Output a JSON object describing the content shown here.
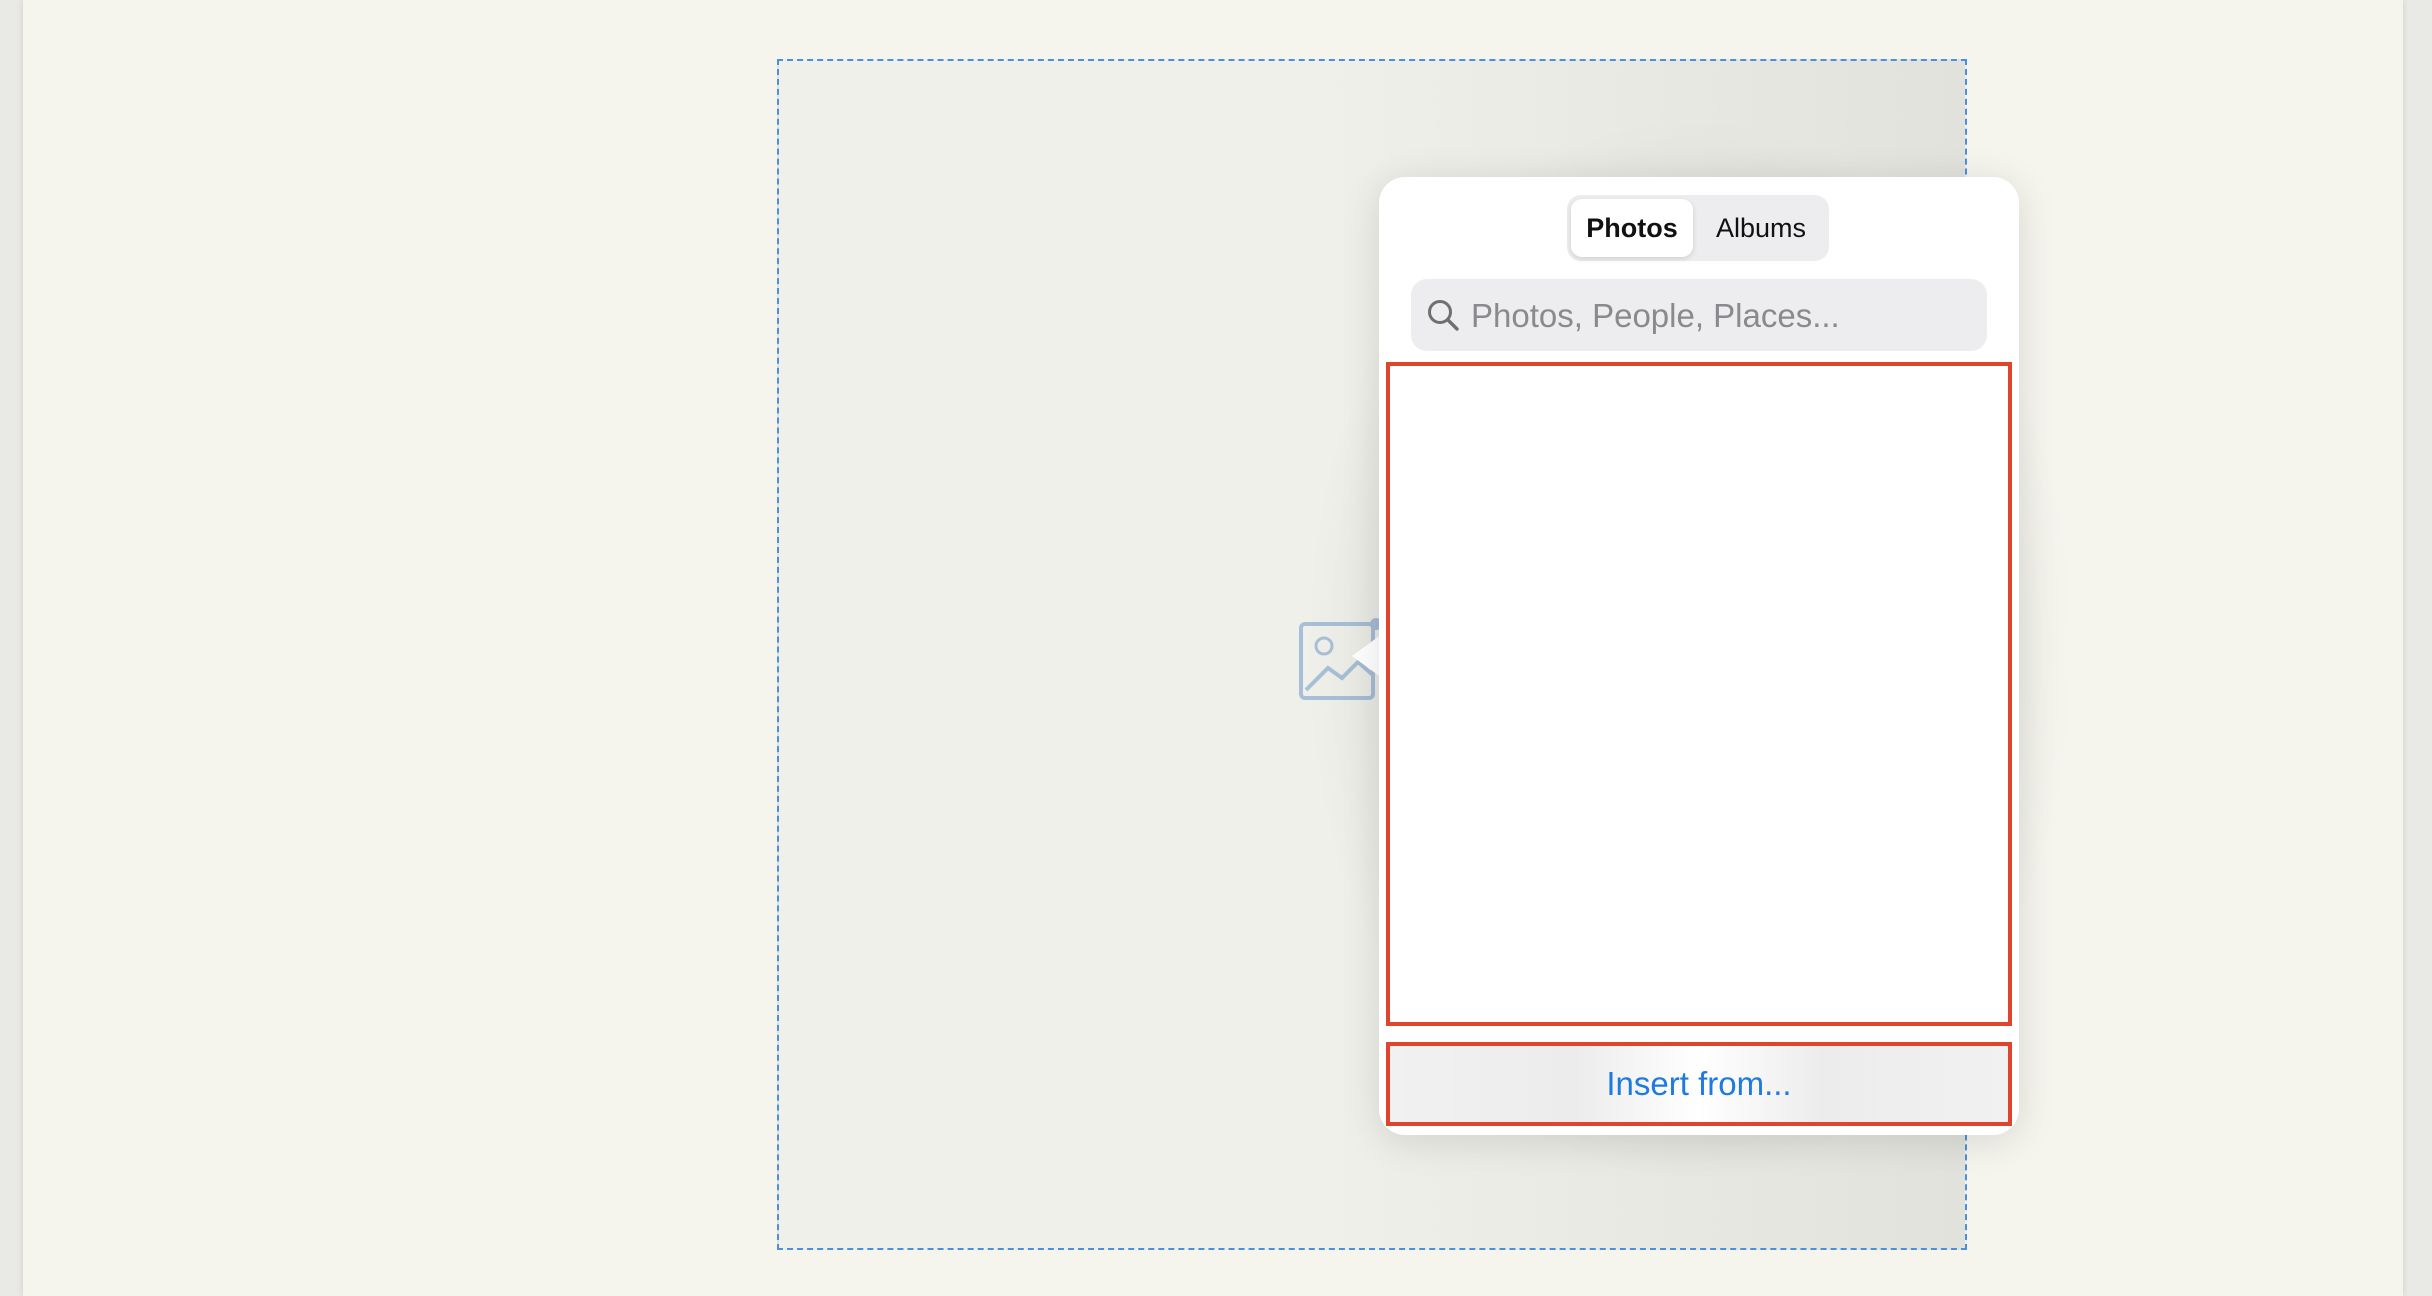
{
  "picker": {
    "tabs": [
      {
        "label": "Photos",
        "selected": true
      },
      {
        "label": "Albums",
        "selected": false
      }
    ],
    "search": {
      "placeholder": "Photos, People, Places...",
      "value": ""
    },
    "insert_from_label": "Insert from..."
  },
  "colors": {
    "accent": "#1f7ae0",
    "highlight_border": "#e0442c",
    "placeholder_border": "#4a8fe0",
    "page_background": "#f5f5ee"
  },
  "icons": {
    "placeholder": "image-placeholder-icon",
    "search": "magnifying-glass-icon"
  }
}
